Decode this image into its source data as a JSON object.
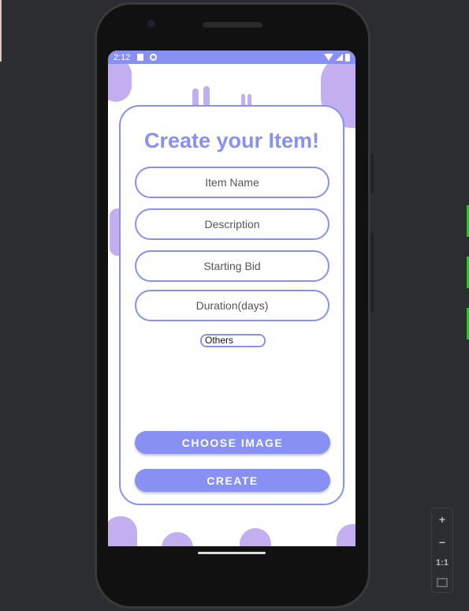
{
  "status_bar": {
    "time": "2:12",
    "icons": [
      "sd-card-icon",
      "notification-icon",
      "wifi-icon",
      "signal-icon",
      "battery-icon"
    ]
  },
  "form": {
    "title": "Create your Item!",
    "fields": [
      {
        "placeholder": "Item Name"
      },
      {
        "placeholder": "Description"
      },
      {
        "placeholder": "Starting Bid"
      },
      {
        "placeholder": "Duration(days)"
      }
    ],
    "category_spinner": {
      "selected": "Others"
    },
    "choose_image_label": "CHOOSE IMAGE",
    "create_label": "CREATE"
  },
  "emulator_controls": {
    "zoom_in": "+",
    "zoom_out": "−",
    "actual_size": "1:1"
  },
  "colors": {
    "accent": "#8891f3",
    "decor": "#c3aff0",
    "background": "#2b2d30"
  }
}
